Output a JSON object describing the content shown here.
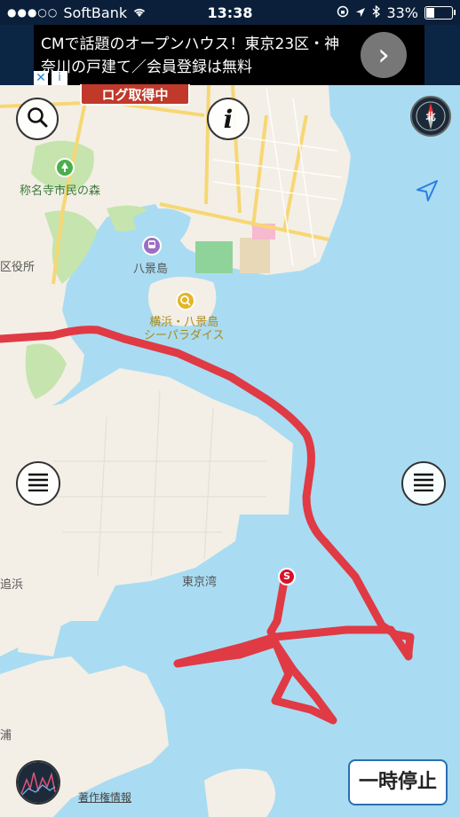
{
  "status_bar": {
    "signal": "●●●○○",
    "carrier": "SoftBank",
    "time": "13:38",
    "battery": "33%",
    "battery_level": 0.33
  },
  "ad": {
    "text": "CMで話題のオープンハウス！東京23区・神奈川の戸建て／会員登録は無料",
    "arrow": "›",
    "close": "✕",
    "info": "i"
  },
  "log_status": "ログ取得中",
  "map_labels": {
    "park": "称名寺市民の森",
    "ward_office": "区役所",
    "station": "八景島",
    "poi": "横浜・八景島\nシーパラダイス",
    "bay": "東京湾",
    "left_1": "追浜",
    "left_2": "浦"
  },
  "route_start_marker": "S",
  "pause_button": "一時停止",
  "copyright": "著作権情報",
  "icons": {
    "search": "search-icon",
    "info": "info-icon",
    "compass": "compass-icon",
    "location": "location-arrow-icon",
    "menu": "menu-icon",
    "compass_label": "北"
  },
  "colors": {
    "water": "#a9dcf2",
    "route": "#e03a45",
    "land": "#f3efe6",
    "park": "#bfe3a5"
  }
}
